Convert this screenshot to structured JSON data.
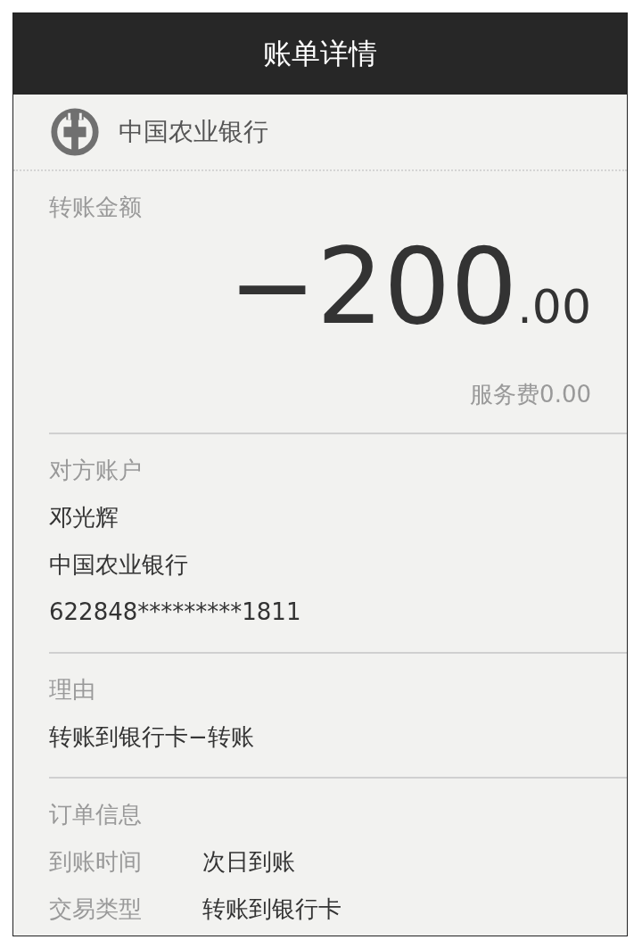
{
  "header": {
    "title": "账单详情"
  },
  "bank": {
    "name": "中国农业银行"
  },
  "amount": {
    "label": "转账金额",
    "integer": "−200",
    "decimal": ".00",
    "fee": "服务费0.00"
  },
  "counterparty": {
    "label": "对方账户",
    "lines": [
      "邓光辉",
      "中国农业银行",
      "622848*********1811"
    ]
  },
  "reason": {
    "label": "理由",
    "text": "转账到银行卡−转账"
  },
  "order": {
    "label": "订单信息",
    "rows": [
      {
        "key": "到账时间",
        "value": "次日到账"
      },
      {
        "key": "交易类型",
        "value": "转账到银行卡"
      }
    ]
  }
}
